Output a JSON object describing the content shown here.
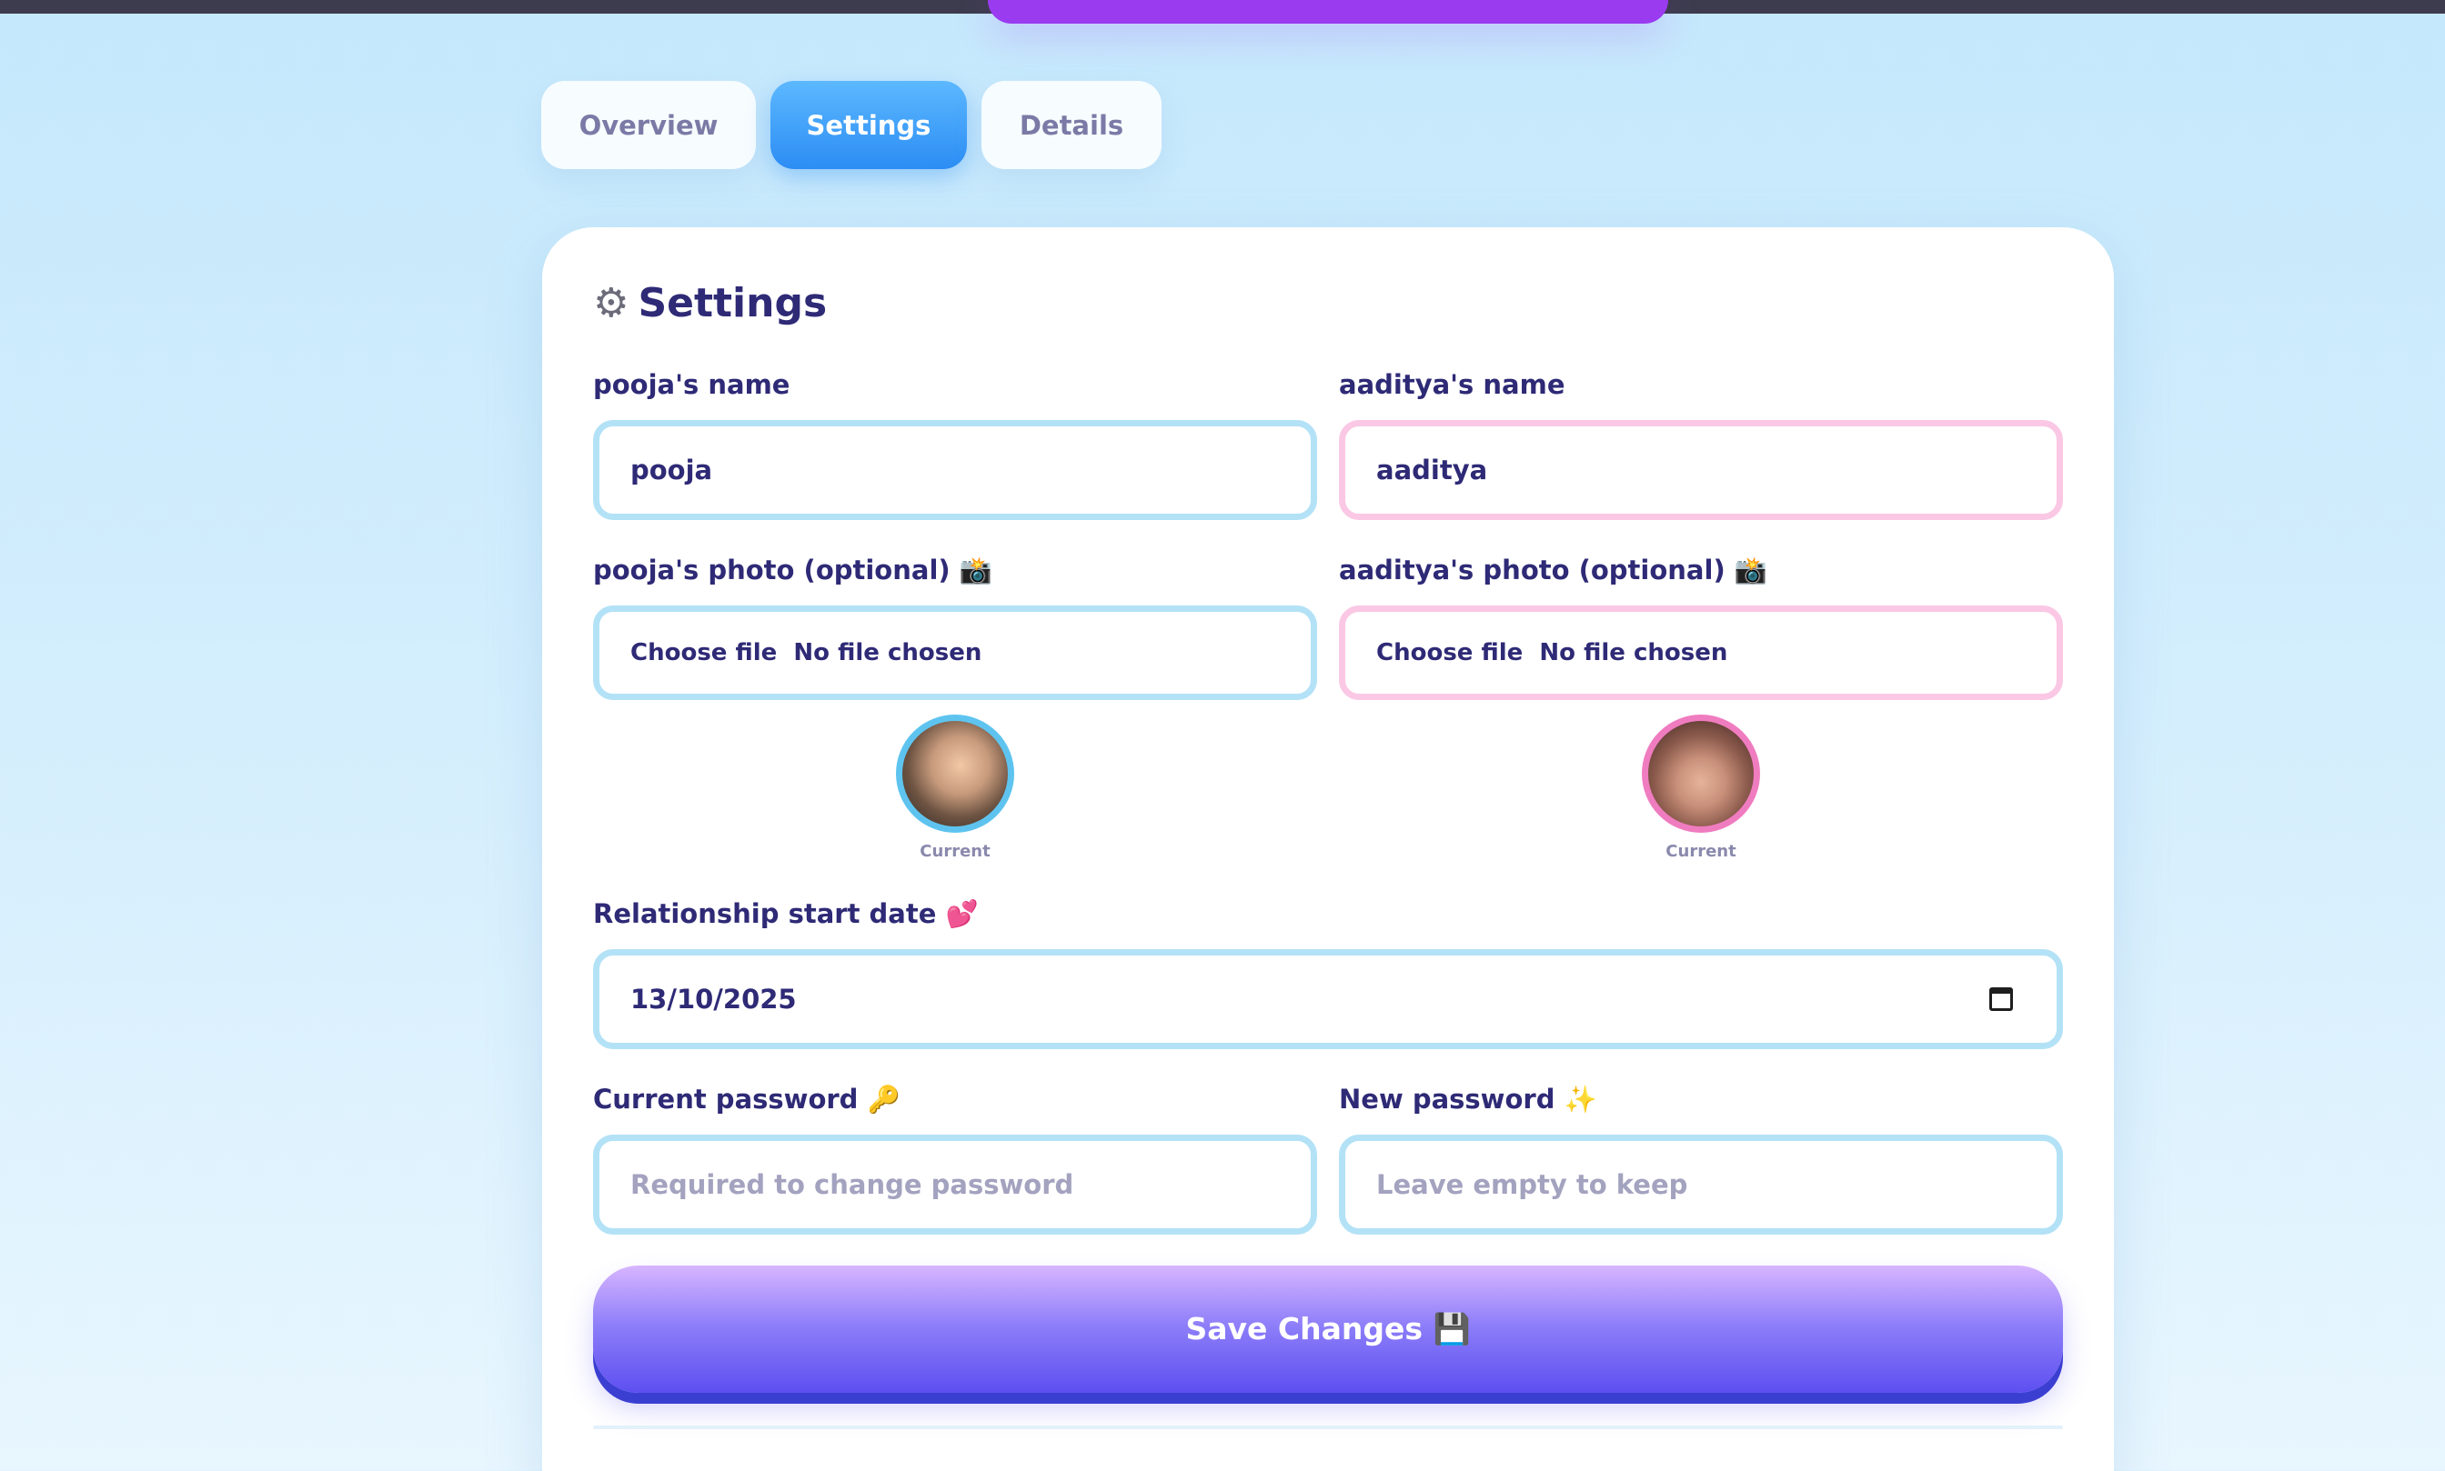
{
  "tabs": [
    {
      "label": "Overview"
    },
    {
      "label": "Settings"
    },
    {
      "label": "Details"
    }
  ],
  "settings": {
    "title": "Settings",
    "title_icon": "gear-icon",
    "partner1": {
      "name_label": "pooja's name",
      "name_value": "pooja",
      "photo_label": "pooja's photo (optional) 📸",
      "file_text": "Choose file  No file chosen",
      "current_label": "Current"
    },
    "partner2": {
      "name_label": "aaditya's name",
      "name_value": "aaditya",
      "photo_label": "aaditya's photo (optional) 📸",
      "file_text": "Choose file  No file chosen",
      "current_label": "Current"
    },
    "start_date_label": "Relationship start date 💕",
    "start_date_value": "13/10/2025",
    "current_password_label": "Current password 🔑",
    "current_password_placeholder": "Required to change password",
    "new_password_label": "New password ✨",
    "new_password_placeholder": "Leave empty to keep",
    "save_label": "Save Changes 💾"
  },
  "colors": {
    "primary_text": "#2e2a76",
    "tab_active": "#2c8df4",
    "field_blue_border": "#b3e2f7",
    "field_pink_border": "#fac8e4",
    "save_button": "#7466f5"
  }
}
